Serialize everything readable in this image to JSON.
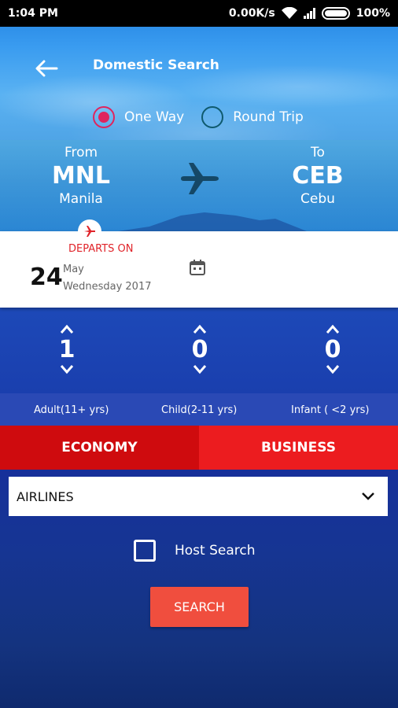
{
  "status_bar": {
    "time": "1:04 PM",
    "speed": "0.00K/s",
    "battery": "100%"
  },
  "header": {
    "title": "Domestic Search"
  },
  "trip_type": {
    "one_way": "One Way",
    "round_trip": "Round Trip",
    "selected": "one_way"
  },
  "route": {
    "from_label": "From",
    "from_code": "MNL",
    "from_city": "Manila",
    "to_label": "To",
    "to_code": "CEB",
    "to_city": "Cebu"
  },
  "departs": {
    "label": "DEPARTS ON",
    "day": "24",
    "month": "May",
    "weekday_year": "Wednesday 2017"
  },
  "passengers": {
    "adult": {
      "count": "1",
      "label": "Adult(11+ yrs)"
    },
    "child": {
      "count": "0",
      "label": "Child(2-11 yrs)"
    },
    "infant": {
      "count": "0",
      "label": "Infant ( <2 yrs)"
    }
  },
  "class": {
    "economy": "ECONOMY",
    "business": "BUSINESS"
  },
  "airlines": {
    "value": "AIRLINES"
  },
  "host_search": {
    "label": "Host Search"
  },
  "search_button": {
    "label": "SEARCH"
  },
  "colors": {
    "accent_red": "#e0242a",
    "radio_pink": "#e0245e",
    "search_orange": "#f04e3e"
  }
}
